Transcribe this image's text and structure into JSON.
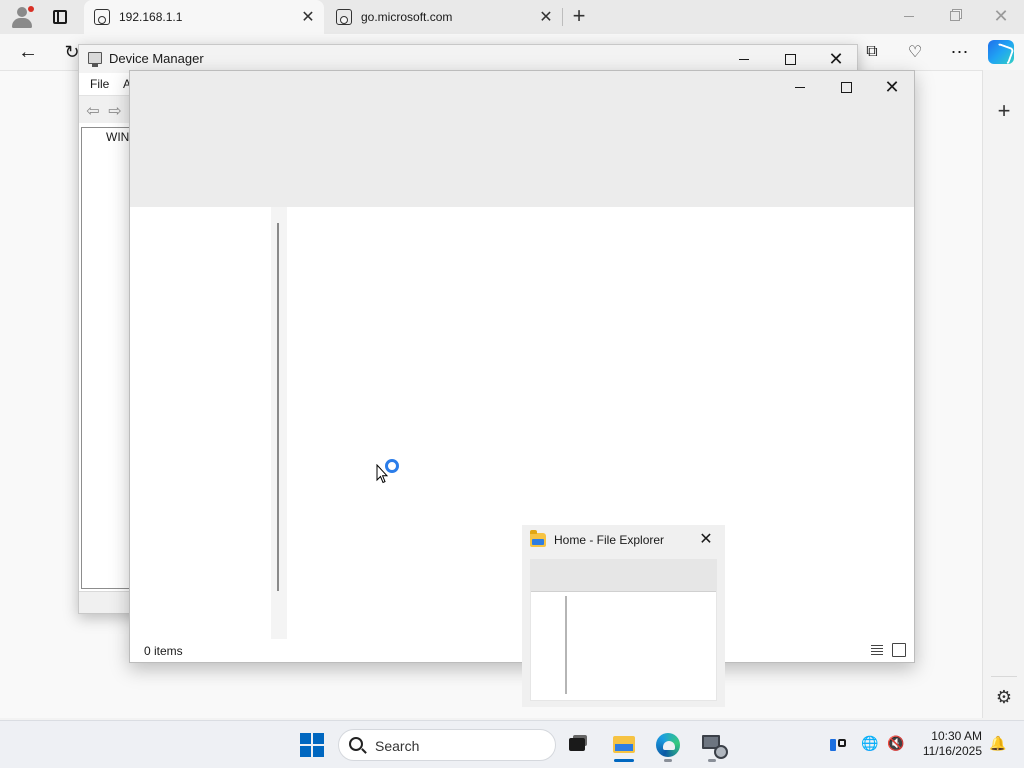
{
  "browser": {
    "tabs": [
      {
        "label": "192.168.1.1",
        "active": true
      },
      {
        "label": "go.microsoft.com",
        "active": false
      }
    ],
    "new_tab_label": "+",
    "close_glyph": "✕"
  },
  "device_manager": {
    "title": "Device Manager",
    "menu": {
      "file": "File",
      "action_partial": "A"
    },
    "tree_root_partial": "WIN-"
  },
  "explorer": {
    "status": "0 items",
    "loading": true
  },
  "preview": {
    "title": "Home - File Explorer"
  },
  "taskbar": {
    "search_placeholder": "Search",
    "time": "10:30 AM",
    "date": "11/16/2025"
  },
  "icons": {
    "profile": "profile-icon",
    "back": "back-arrow-icon",
    "reload": "reload-icon",
    "split_screen": "split-screen-icon",
    "performance": "performance-icon",
    "more": "more-icon",
    "copilot": "copilot-icon",
    "settings": "gear-icon"
  },
  "colors": {
    "accent": "#0067c0",
    "busy_ring": "#2b7de9",
    "folder": "#f6c343"
  }
}
